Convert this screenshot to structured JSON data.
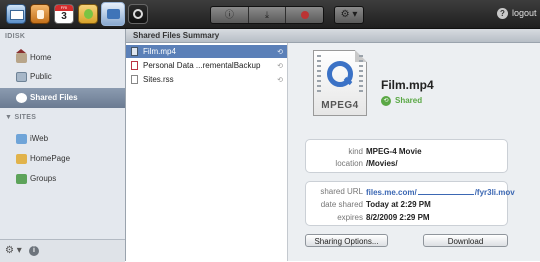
{
  "toolbar": {
    "apps": [
      {
        "name": "mail-icon"
      },
      {
        "name": "contacts-icon"
      },
      {
        "name": "calendar-icon",
        "month": "FRI",
        "day": "3"
      },
      {
        "name": "gallery-icon"
      },
      {
        "name": "idisk-icon"
      },
      {
        "name": "find-my-iphone-icon"
      }
    ],
    "actions": [
      "info-icon",
      "download-icon",
      "delete-icon"
    ],
    "gear_menu": "⚙ ▾",
    "help_glyph": "?",
    "logout_label": "logout"
  },
  "sidebar": {
    "sections": [
      {
        "header": "IDISK",
        "items": [
          {
            "label": "Home",
            "icon": "home-icon"
          },
          {
            "label": "Public",
            "icon": "public-folder-icon"
          },
          {
            "label": "Shared Files",
            "icon": "shared-icon",
            "selected": true
          }
        ]
      },
      {
        "header": "▼ SITES",
        "items": [
          {
            "label": "iWeb",
            "icon": "iweb-icon"
          },
          {
            "label": "HomePage",
            "icon": "homepage-icon"
          },
          {
            "label": "Groups",
            "icon": "groups-icon"
          }
        ]
      }
    ],
    "footer": {
      "gear": "⚙ ▾",
      "info": "i"
    }
  },
  "main": {
    "header": "Shared Files Summary",
    "files": [
      {
        "name": "Film.mp4",
        "selected": true
      },
      {
        "name": "Personal Data ...rementalBackup"
      },
      {
        "name": "Sites.rss"
      }
    ]
  },
  "detail": {
    "icon_label": "MPEG4",
    "title": "Film.mp4",
    "status": "Shared",
    "kind_label": "kind",
    "kind_value": "MPEG-4 Movie",
    "location_label": "location",
    "location_value": "/Movies/",
    "url_label": "shared URL",
    "url_prefix": "files.me.com/",
    "url_suffix": "/fyr3li.mov",
    "date_label": "date shared",
    "date_value": "Today at 2:29 PM",
    "expires_label": "expires",
    "expires_value": "8/2/2009 2:29 PM",
    "sharing_button": "Sharing Options...",
    "download_button": "Download"
  }
}
